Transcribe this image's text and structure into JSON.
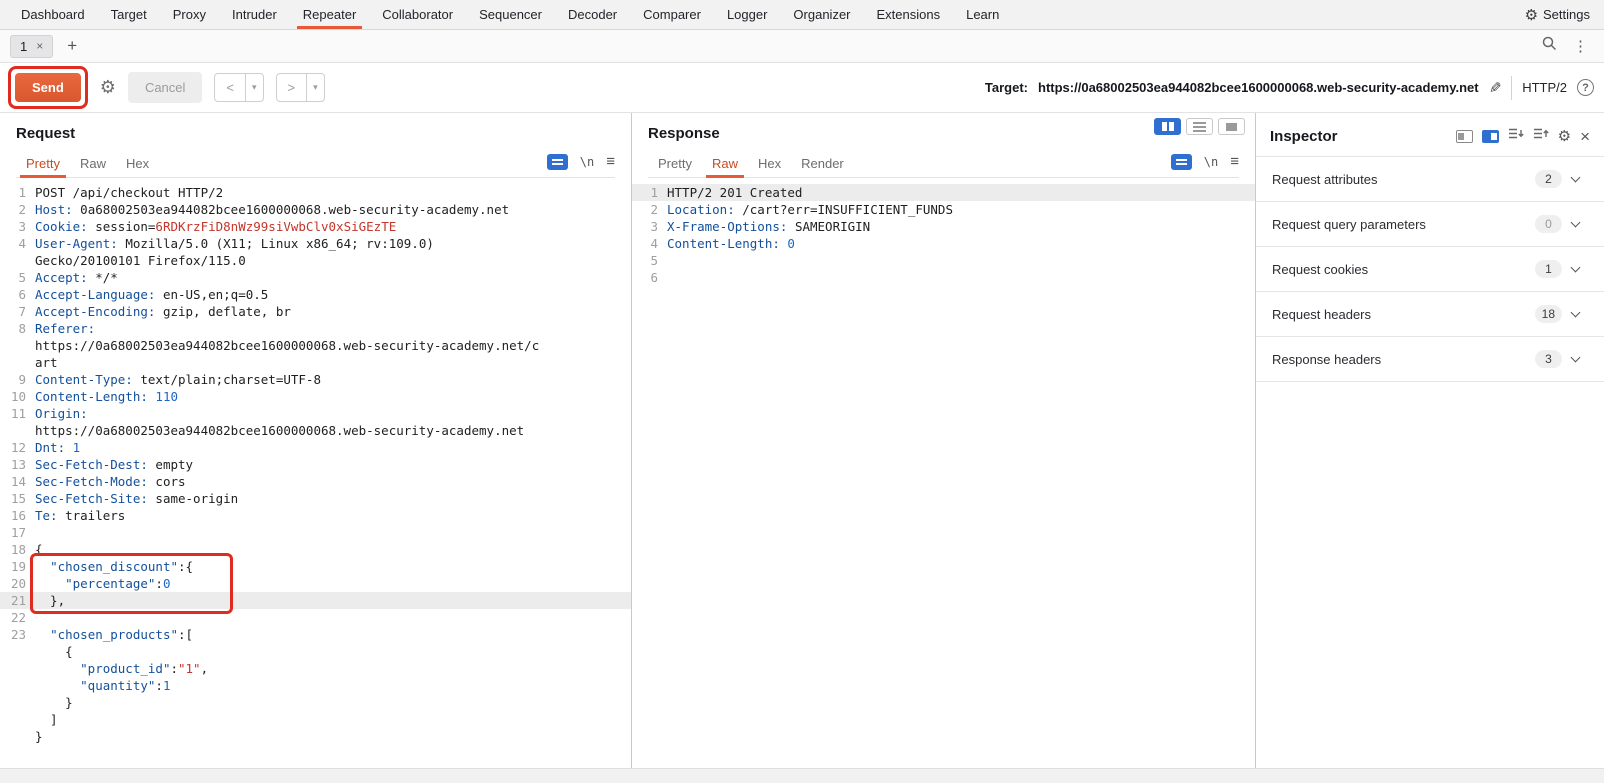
{
  "colors": {
    "accent": "#e8593a",
    "annotation": "#e02b20",
    "send_button": "#d9572e",
    "active_icon_blue": "#2f6fd0",
    "header_name": "#13509c",
    "value_red": "#c3362b",
    "number_blue": "#1c66c7"
  },
  "menu": {
    "items": [
      "Dashboard",
      "Target",
      "Proxy",
      "Intruder",
      "Repeater",
      "Collaborator",
      "Sequencer",
      "Decoder",
      "Comparer",
      "Logger",
      "Organizer",
      "Extensions",
      "Learn"
    ],
    "active": "Repeater",
    "settings_label": "Settings"
  },
  "tabs": {
    "tab1": "1",
    "close": "×",
    "add": "+",
    "more": "⋮"
  },
  "toolbar": {
    "send": "Send",
    "cancel": "Cancel",
    "back": "<",
    "forward": ">",
    "dropdown": "▾",
    "target_label": "Target:",
    "target_url": "https://0a68002503ea944082bcee1600000068.web-security-academy.net",
    "protocol": "HTTP/2",
    "help": "?"
  },
  "editor_icons": {
    "nl": "\\n",
    "menu": "≡"
  },
  "request": {
    "title": "Request",
    "tabs": [
      "Pretty",
      "Raw",
      "Hex"
    ],
    "active_tab": "Pretty",
    "lines": [
      {
        "n": "1",
        "t": [
          [
            "POST /api/checkout HTTP/2",
            "p"
          ]
        ]
      },
      {
        "n": "2",
        "t": [
          [
            "Host:",
            "h"
          ],
          [
            " 0a68002503ea944082bcee1600000068.web-security-academy.net",
            "p"
          ]
        ]
      },
      {
        "n": "3",
        "t": [
          [
            "Cookie:",
            "h"
          ],
          [
            " session=",
            "p"
          ],
          [
            "6RDKrzFiD8nWz99siVwbClv0xSiGEzTE",
            "r"
          ]
        ]
      },
      {
        "n": "4",
        "t": [
          [
            "User-Agent:",
            "h"
          ],
          [
            " Mozilla/5.0 (X11; Linux x86_64; rv:109.0)",
            "p"
          ]
        ]
      },
      {
        "n": "",
        "t": [
          [
            "Gecko/20100101 Firefox/115.0",
            "p"
          ]
        ]
      },
      {
        "n": "5",
        "t": [
          [
            "Accept:",
            "h"
          ],
          [
            " */*",
            "p"
          ]
        ]
      },
      {
        "n": "6",
        "t": [
          [
            "Accept-Language:",
            "h"
          ],
          [
            " en-US,en;q=0.5",
            "p"
          ]
        ]
      },
      {
        "n": "7",
        "t": [
          [
            "Accept-Encoding:",
            "h"
          ],
          [
            " gzip, deflate, br",
            "p"
          ]
        ]
      },
      {
        "n": "8",
        "t": [
          [
            "Referer:",
            "h"
          ]
        ]
      },
      {
        "n": "",
        "t": [
          [
            "https://0a68002503ea944082bcee1600000068.web-security-academy.net/c",
            "p"
          ]
        ]
      },
      {
        "n": "",
        "t": [
          [
            "art",
            "p"
          ]
        ]
      },
      {
        "n": "9",
        "t": [
          [
            "Content-Type:",
            "h"
          ],
          [
            " text/plain;charset=UTF-8",
            "p"
          ]
        ]
      },
      {
        "n": "10",
        "t": [
          [
            "Content-Length:",
            "h"
          ],
          [
            " 110",
            "n"
          ]
        ]
      },
      {
        "n": "11",
        "t": [
          [
            "Origin:",
            "h"
          ]
        ]
      },
      {
        "n": "",
        "t": [
          [
            "https://0a68002503ea944082bcee1600000068.web-security-academy.net",
            "p"
          ]
        ]
      },
      {
        "n": "12",
        "t": [
          [
            "Dnt:",
            "h"
          ],
          [
            " 1",
            "n"
          ]
        ]
      },
      {
        "n": "13",
        "t": [
          [
            "Sec-Fetch-Dest:",
            "h"
          ],
          [
            " empty",
            "p"
          ]
        ]
      },
      {
        "n": "14",
        "t": [
          [
            "Sec-Fetch-Mode:",
            "h"
          ],
          [
            " cors",
            "p"
          ]
        ]
      },
      {
        "n": "15",
        "t": [
          [
            "Sec-Fetch-Site:",
            "h"
          ],
          [
            " same-origin",
            "p"
          ]
        ]
      },
      {
        "n": "16",
        "t": [
          [
            "Te:",
            "h"
          ],
          [
            " trailers",
            "p"
          ]
        ]
      },
      {
        "n": "17",
        "t": []
      },
      {
        "n": "18",
        "t": [
          [
            "{",
            "p"
          ]
        ]
      },
      {
        "n": "19",
        "t": [
          [
            "  ",
            "p"
          ],
          [
            "\"chosen_discount\"",
            "h"
          ],
          [
            ":{",
            "p"
          ]
        ]
      },
      {
        "n": "20",
        "t": [
          [
            "    ",
            "p"
          ],
          [
            "\"percentage\"",
            "h"
          ],
          [
            ":",
            "p"
          ],
          [
            "0",
            "n"
          ]
        ]
      },
      {
        "n": "21",
        "t": [
          [
            "  },",
            "p"
          ]
        ],
        "hl": true
      },
      {
        "n": "22",
        "t": []
      },
      {
        "n": "23",
        "t": [
          [
            "  ",
            "p"
          ],
          [
            "\"chosen_products\"",
            "h"
          ],
          [
            ":[",
            "p"
          ]
        ]
      },
      {
        "n": "",
        "t": [
          [
            "    {",
            "p"
          ]
        ]
      },
      {
        "n": "",
        "t": [
          [
            "      ",
            "p"
          ],
          [
            "\"product_id\"",
            "h"
          ],
          [
            ":",
            "p"
          ],
          [
            "\"1\"",
            "r"
          ],
          [
            ",",
            "p"
          ]
        ]
      },
      {
        "n": "",
        "t": [
          [
            "      ",
            "p"
          ],
          [
            "\"quantity\"",
            "h"
          ],
          [
            ":",
            "p"
          ],
          [
            "1",
            "n"
          ]
        ]
      },
      {
        "n": "",
        "t": [
          [
            "    }",
            "p"
          ]
        ]
      },
      {
        "n": "",
        "t": [
          [
            "  ]",
            "p"
          ]
        ]
      },
      {
        "n": "",
        "t": [
          [
            "}",
            "p"
          ]
        ]
      }
    ]
  },
  "response": {
    "title": "Response",
    "tabs": [
      "Pretty",
      "Raw",
      "Hex",
      "Render"
    ],
    "active_tab": "Raw",
    "lines": [
      {
        "n": "1",
        "t": [
          [
            "HTTP/2 201 Created",
            "p"
          ]
        ],
        "hl": true
      },
      {
        "n": "2",
        "t": [
          [
            "Location:",
            "h"
          ],
          [
            " /cart?err=INSUFFICIENT_FUNDS",
            "p"
          ]
        ]
      },
      {
        "n": "3",
        "t": [
          [
            "X-Frame-Options:",
            "h"
          ],
          [
            " SAMEORIGIN",
            "p"
          ]
        ]
      },
      {
        "n": "4",
        "t": [
          [
            "Content-Length:",
            "h"
          ],
          [
            " 0",
            "n"
          ]
        ]
      },
      {
        "n": "5",
        "t": []
      },
      {
        "n": "6",
        "t": []
      }
    ]
  },
  "inspector": {
    "title": "Inspector",
    "sections": [
      {
        "label": "Request attributes",
        "count": "2"
      },
      {
        "label": "Request query parameters",
        "count": "0"
      },
      {
        "label": "Request cookies",
        "count": "1"
      },
      {
        "label": "Request headers",
        "count": "18"
      },
      {
        "label": "Response headers",
        "count": "3"
      }
    ]
  }
}
